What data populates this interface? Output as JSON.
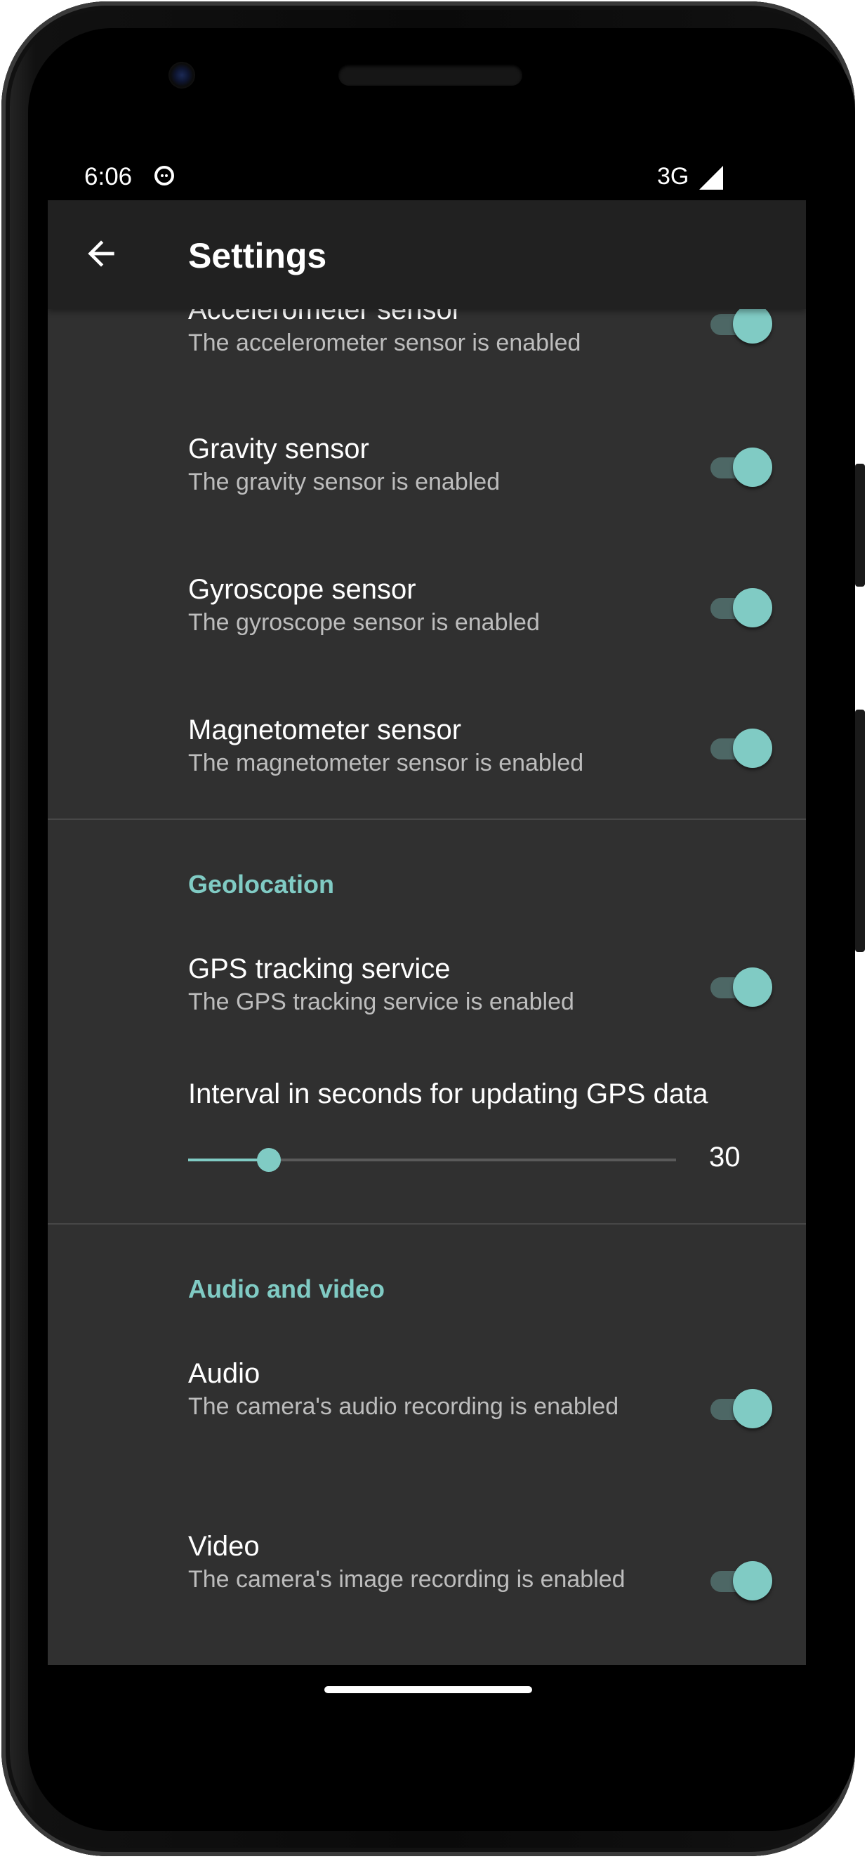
{
  "status_bar": {
    "time": "6:06",
    "network": "3G"
  },
  "app_bar": {
    "title": "Settings"
  },
  "sensors": [
    {
      "title": "Accelerometer sensor",
      "summary": "The accelerometer sensor is enabled",
      "checked": true
    },
    {
      "title": "Gravity sensor",
      "summary": "The gravity sensor is enabled",
      "checked": true
    },
    {
      "title": "Gyroscope sensor",
      "summary": "The gyroscope sensor is enabled",
      "checked": true
    },
    {
      "title": "Magnetometer sensor",
      "summary": "The magnetometer sensor is enabled",
      "checked": true
    }
  ],
  "geolocation": {
    "header": "Geolocation",
    "gps": {
      "title": "GPS tracking service",
      "summary": "The GPS tracking service is enabled",
      "checked": true
    },
    "interval": {
      "title": "Interval in seconds for updating GPS data",
      "value": "30",
      "fill_fraction": 0.165
    }
  },
  "audio_video": {
    "header": "Audio and video",
    "audio": {
      "title": "Audio",
      "summary": "The camera's audio recording is enabled",
      "checked": true
    },
    "video": {
      "title": "Video",
      "summary": "The camera's image recording is enabled",
      "checked": true
    }
  },
  "colors": {
    "accent": "#80cbc4",
    "background": "#303030",
    "app_bar": "#212121"
  }
}
